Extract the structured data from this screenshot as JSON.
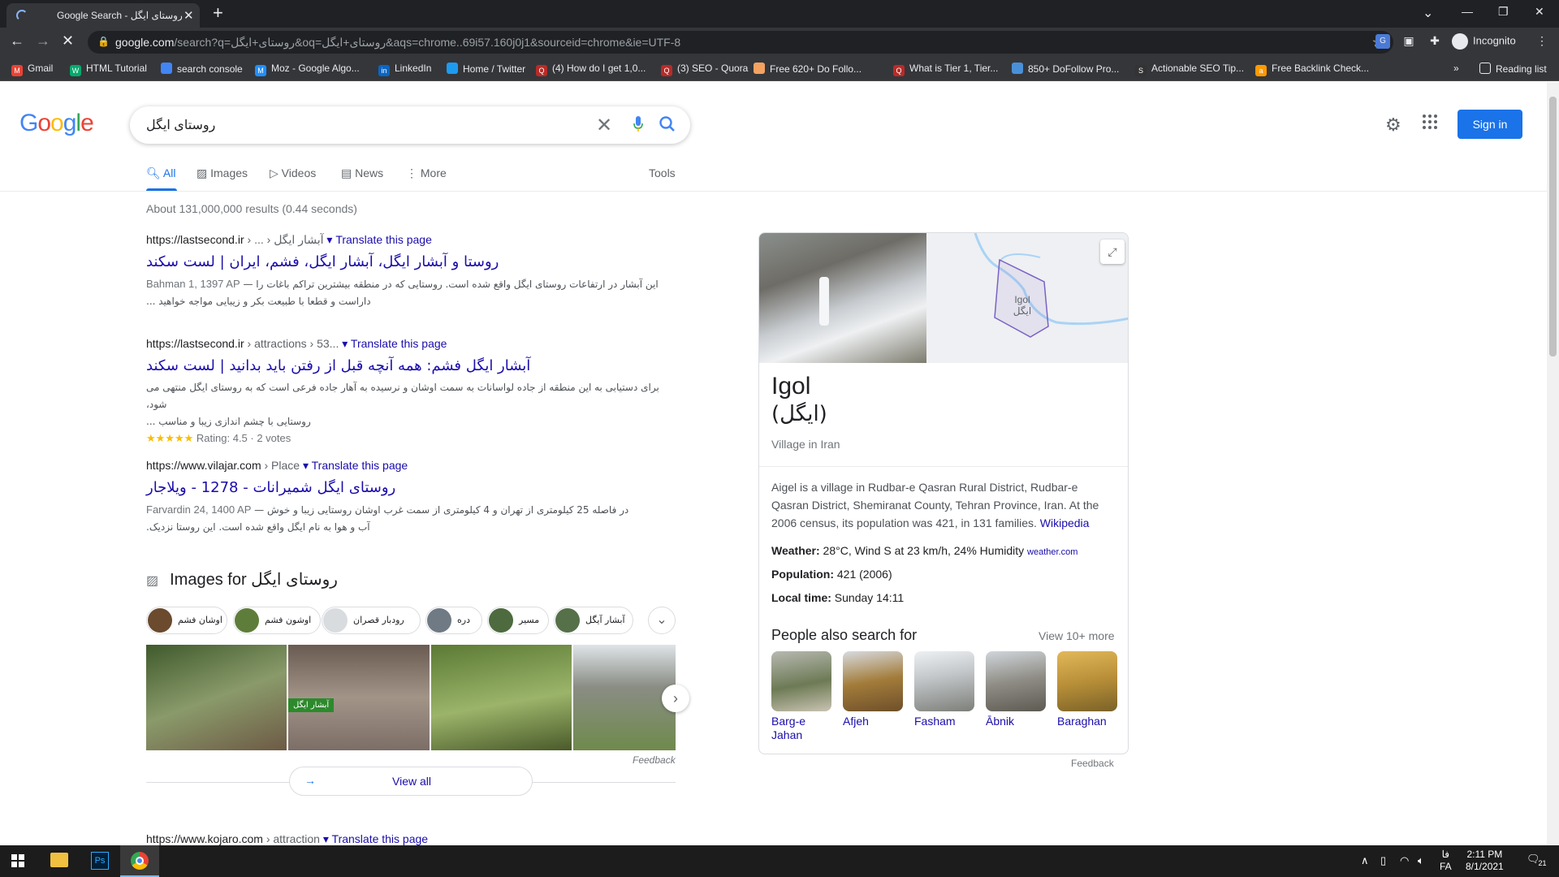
{
  "browser": {
    "tab_title": "Google Search - روستای ایگل",
    "url_domain": "google.com",
    "url_rest": "/search?q=روستای+ایگل&oq=روستای+ایگل&aqs=chrome..69i57.160j0j1&sourceid=chrome&ie=UTF-8",
    "profile_label": "Incognito",
    "reading_list": "Reading list",
    "bookmarks": [
      {
        "label": "Gmail",
        "color": "#ea4335",
        "icon": "M"
      },
      {
        "label": "HTML Tutorial",
        "color": "#04aa6d",
        "icon": "W"
      },
      {
        "label": "search console",
        "color": "#4285f4",
        "icon": ""
      },
      {
        "label": "Moz - Google Algo...",
        "color": "#1e90ff",
        "icon": "M"
      },
      {
        "label": "LinkedIn",
        "color": "#0a66c2",
        "icon": "in"
      },
      {
        "label": "Home / Twitter",
        "color": "#1d9bf0",
        "icon": ""
      },
      {
        "label": "(4) How do I get 1,0...",
        "color": "#b92b27",
        "icon": "Q"
      },
      {
        "label": "(3) SEO - Quora",
        "color": "#b92b27",
        "icon": "Q"
      },
      {
        "label": "Free 620+ Do Follo...",
        "color": "#f4a261",
        "icon": ""
      },
      {
        "label": "What is Tier 1, Tier...",
        "color": "#b92b27",
        "icon": "Q"
      },
      {
        "label": "850+ DoFollow Pro...",
        "color": "#4a90d9",
        "icon": ""
      },
      {
        "label": "Actionable SEO Tip...",
        "color": "#333333",
        "icon": "S"
      },
      {
        "label": "Free Backlink Check...",
        "color": "#ff9900",
        "icon": "a"
      }
    ]
  },
  "google": {
    "logo": "Google",
    "query": "روستای ایگل",
    "signin": "Sign in",
    "tabs": [
      "All",
      "Images",
      "Videos",
      "News",
      "More"
    ],
    "tools": "Tools",
    "stats": "About 131,000,000 results (0.44 seconds)",
    "translate": "Translate this page",
    "results": [
      {
        "site": "https://lastsecond.ir",
        "path": " › ... › آبشار ایگل",
        "title": "روستا و آبشار ایگل، آبشار ایگل، فشم، ایران | لست سکند",
        "date": "Bahman 1, 1397 AP",
        "snippet1": "این آبشار در ارتفاعات روستای ایگل واقع شده است. روستایی که در منطقه بیشترین تراکم باغات را — ",
        "snippet2": "داراست و قطعا با طبیعت بکر و زیبایی مواجه خواهید ..."
      },
      {
        "site": "https://lastsecond.ir",
        "path": " › attractions › 53...",
        "title": "آبشار ایگل فشم: همه آنچه قبل از رفتن باید بدانید | لست سکند",
        "snippet1": "برای دستیابی به این منطقه از جاده لواسانات به سمت اوشان و نرسیده به آهار جاده فرعی است که به روستای ایگل منتهی می شود،",
        "snippet2": "روستایی با چشم اندازی زیبا و مناسب ...",
        "stars": "★★★★★",
        "rating": "Rating: 4.5 · 2 votes"
      },
      {
        "site": "https://www.vilajar.com",
        "path": " › Place",
        "title": "روستای ایگل شمیرانات - 1278 - ویلاجار",
        "date": "Farvardin 24, 1400 AP",
        "snippet1": "در فاصله 25 کیلومتری از تهران و 4 کیلومتری از سمت غرب اوشان روستایی زیبا و خوش — ",
        "snippet2": "آب و هوا به نام ایگل واقع شده است. این روستا نزدیک."
      }
    ],
    "images_heading": "Images for روستای ایگل",
    "chips": [
      "اوشان فشم",
      "اوشون فشم",
      "رودبار قصران",
      "دره",
      "مسیر",
      "آبشار آیگل"
    ],
    "image_overlay_text": "آبشار ایگل",
    "feedback": "Feedback",
    "view_all": "View all",
    "last_result": {
      "site": "https://www.kojaro.com",
      "path": " › attraction"
    }
  },
  "knowledge_panel": {
    "title": "Igol",
    "subtitle": "(ایگل)",
    "type": "Village in Iran",
    "map_label_en": "Igol",
    "map_label_fa": "ایگل",
    "description": "Aigel is a village in Rudbar-e Qasran Rural District, Rudbar-e Qasran District, Shemiranat County, Tehran Province, Iran. At the 2006 census, its population was 421, in 131 families.",
    "wiki_link": "Wikipedia",
    "weather_label": "Weather:",
    "weather_value": "28°C, Wind S at 23 km/h, 24% Humidity",
    "weather_source": "weather.com",
    "population_label": "Population:",
    "population_value": "421 (2006)",
    "localtime_label": "Local time:",
    "localtime_value": "Sunday 14:11",
    "people_also_search": "People also search for",
    "view_more": "View 10+ more",
    "places": [
      "Barg-e Jahan",
      "Afjeh",
      "Fasham",
      "Ābnik",
      "Baraghan"
    ],
    "feedback": "Feedback"
  },
  "taskbar": {
    "time": "2:11 PM",
    "date": "8/1/2021",
    "lang": "FA",
    "lang_fa": "فا",
    "notif_count": "21"
  }
}
